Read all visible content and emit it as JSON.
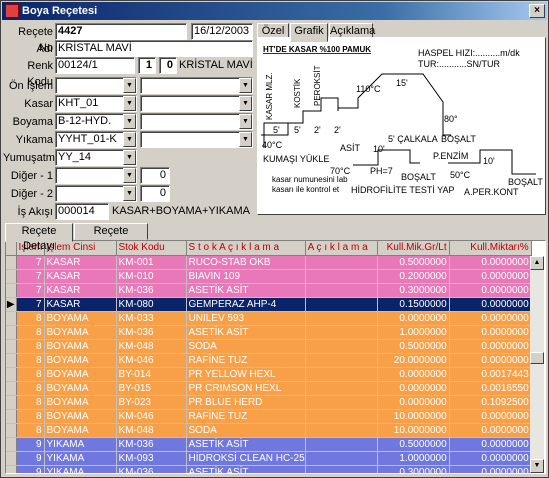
{
  "window": {
    "title": "Boya Reçetesi",
    "close": "×"
  },
  "form": {
    "recete_no_label": "Reçete No",
    "recete_no": "4427",
    "date": "16/12/2003",
    "adi_label": "Adı",
    "adi": "KRİSTAL MAVİ",
    "renk_kodu_label": "Renk Kodu",
    "renk_kodu": "00124/1",
    "renk_n1": "1",
    "renk_n2": "0",
    "renk_name": "KRİSTAL MAVİ",
    "on_islem_label": "Ön İşlem",
    "on_islem": "",
    "kasar_label": "Kasar",
    "kasar": "KHT_01",
    "boyama_label": "Boyama",
    "boyama": "B-12-HYD.",
    "yikama_label": "Yıkama",
    "yikama": "YYHT_01-K",
    "yumusatma_label": "Yumuşatma",
    "yumusatma": "YY_14",
    "diger1_label": "Diğer - 1",
    "diger1_val": "0",
    "diger2_label": "Diğer - 2",
    "diger2_val": "0",
    "is_akisi_label": "İş Akışı",
    "is_akisi": "000014",
    "is_akisi_text": "KASAR+BOYAMA+YIKAMA"
  },
  "top_tabs": [
    "Özel",
    "Grafik",
    "Açıklama"
  ],
  "diagram": {
    "title": "HT'DE KASAR  %100 PAMUK",
    "haspel": "HASPEL  HIZI:..........m/dk",
    "tur": "TUR:...........SN/TUR",
    "kasar_mlz": "KASAR MLZ.",
    "kostik": "KOSTİK",
    "peroksit": "PEROKSİT",
    "t110": "110°C",
    "t15": "15'",
    "t80": "80°",
    "t40": "40°C",
    "m5a": "5'",
    "m5b": "5'",
    "m2a": "2'",
    "m2b": "2'",
    "kumasi_yukle": "KUMAŞI YÜKLE",
    "asit": "ASİT",
    "m10": "10'",
    "calkala": "5' ÇALKALA",
    "bosalt1": "BOŞALT",
    "penzim": "P.ENZİM",
    "t70": "70°C",
    "ph7": "PH=7",
    "m10b": "10'",
    "t50": "50°C",
    "note1": "kasar numunesini lab",
    "note2": "kasarı ile kontrol et",
    "bosalt2": "BOŞALT",
    "bosalt3": "BOŞALT",
    "hidrofilite": "HİDROFİLİTE TESTİ YAP",
    "aperkont": "A.PER.KONT"
  },
  "bottom_tabs": [
    "Reçete Detayı",
    "Reçete Giderleri"
  ],
  "grid": {
    "columns": [
      "İşlem",
      "İşlem Cinsi",
      "Stok Kodu",
      "S t o k   A ç ı k l a m a",
      "A ç ı k l a m a",
      "Kull.Mik.Gr/Lt",
      "Kull.Miktarı%"
    ],
    "rows": [
      {
        "islem": "7",
        "cins": "KASAR",
        "kod": "KM-001",
        "aciklama": "RUCO-STAB OKB",
        "not": "",
        "gr": "0.5000000",
        "yuzde": "0.0000000",
        "color": "#e878b8"
      },
      {
        "islem": "7",
        "cins": "KASAR",
        "kod": "KM-010",
        "aciklama": "BIAVIN 109",
        "not": "",
        "gr": "0.2000000",
        "yuzde": "0.0000000",
        "color": "#e878b8"
      },
      {
        "islem": "7",
        "cins": "KASAR",
        "kod": "KM-036",
        "aciklama": "ASETİK ASİT",
        "not": "",
        "gr": "0.3000000",
        "yuzde": "0.0000000",
        "color": "#e878b8"
      },
      {
        "islem": "7",
        "cins": "KASAR",
        "kod": "KM-080",
        "aciklama": "GEMPERAZ AHP-4",
        "not": "",
        "gr": "0.1500000",
        "yuzde": "0.0000000",
        "color": "#e878b8",
        "selected": true
      },
      {
        "islem": "8",
        "cins": "BOYAMA",
        "kod": "KM-033",
        "aciklama": "UNILEV 593",
        "not": "",
        "gr": "0.0000000",
        "yuzde": "0.0000000",
        "color": "#f8a048"
      },
      {
        "islem": "8",
        "cins": "BOYAMA",
        "kod": "KM-036",
        "aciklama": "ASETİK ASİT",
        "not": "",
        "gr": "1.0000000",
        "yuzde": "0.0000000",
        "color": "#f8a048"
      },
      {
        "islem": "8",
        "cins": "BOYAMA",
        "kod": "KM-048",
        "aciklama": "SODA",
        "not": "",
        "gr": "0.5000000",
        "yuzde": "0.0000000",
        "color": "#f8a048"
      },
      {
        "islem": "8",
        "cins": "BOYAMA",
        "kod": "KM-046",
        "aciklama": "RAFİNE TUZ",
        "not": "",
        "gr": "20.0000000",
        "yuzde": "0.0000000",
        "color": "#f8a048"
      },
      {
        "islem": "8",
        "cins": "BOYAMA",
        "kod": "BY-014",
        "aciklama": "PR YELLOW HEXL",
        "not": "",
        "gr": "0.0000000",
        "yuzde": "0.0017443",
        "color": "#f8a048"
      },
      {
        "islem": "8",
        "cins": "BOYAMA",
        "kod": "BY-015",
        "aciklama": "PR CRIMSON HEXL",
        "not": "",
        "gr": "0.0000000",
        "yuzde": "0.0016550",
        "color": "#f8a048"
      },
      {
        "islem": "8",
        "cins": "BOYAMA",
        "kod": "BY-023",
        "aciklama": "PR BLUE HERD",
        "not": "",
        "gr": "0.0000000",
        "yuzde": "0.1092500",
        "color": "#f8a048"
      },
      {
        "islem": "8",
        "cins": "BOYAMA",
        "kod": "KM-046",
        "aciklama": "RAFİNE TUZ",
        "not": "",
        "gr": "10.0000000",
        "yuzde": "0.0000000",
        "color": "#f8a048"
      },
      {
        "islem": "8",
        "cins": "BOYAMA",
        "kod": "KM-048",
        "aciklama": "SODA",
        "not": "",
        "gr": "10.0000000",
        "yuzde": "0.0000000",
        "color": "#f8a048"
      },
      {
        "islem": "9",
        "cins": "YIKAMA",
        "kod": "KM-036",
        "aciklama": "ASETİK ASİT",
        "not": "",
        "gr": "0.5000000",
        "yuzde": "0.0000000",
        "color": "#7078e0"
      },
      {
        "islem": "9",
        "cins": "YIKAMA",
        "kod": "KM-093",
        "aciklama": "HİDROKSİ CLEAN HC-25",
        "not": "",
        "gr": "1.0000000",
        "yuzde": "0.0000000",
        "color": "#7078e0"
      },
      {
        "islem": "9",
        "cins": "YIKAMA",
        "kod": "KM-036",
        "aciklama": "ASETİK ASİT",
        "not": "",
        "gr": "0.3000000",
        "yuzde": "0.0000000",
        "color": "#7078e0"
      }
    ]
  }
}
